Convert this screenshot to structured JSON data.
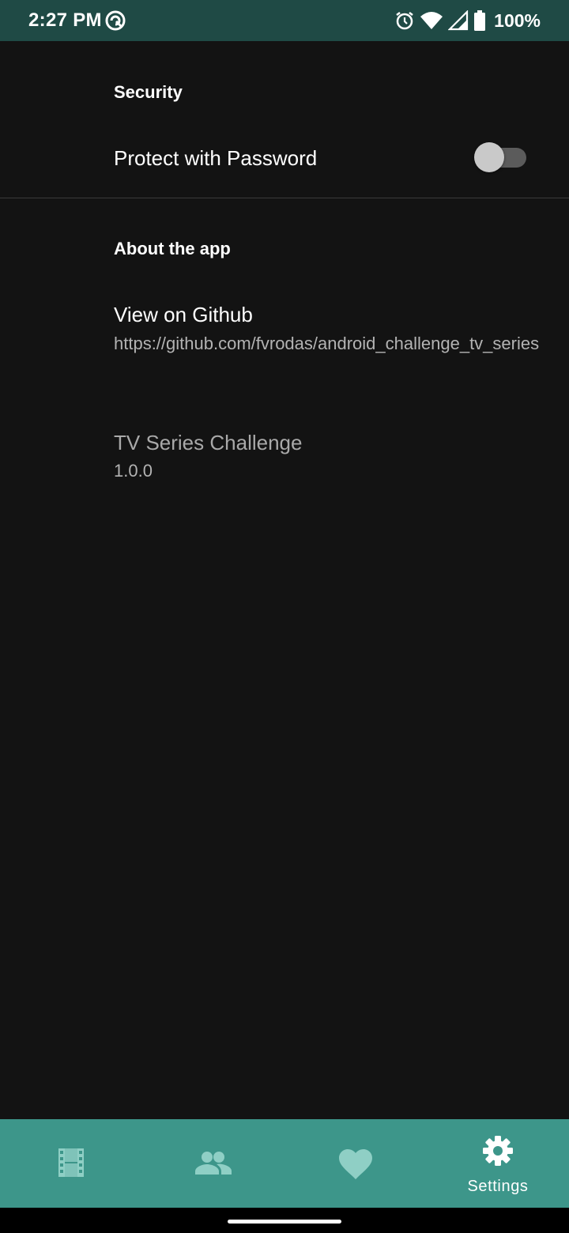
{
  "status_bar": {
    "time": "2:27 PM",
    "battery_percent": "100%",
    "icons": [
      "q-circle-icon",
      "alarm-icon",
      "wifi-icon",
      "cell-signal-icon",
      "battery-icon"
    ]
  },
  "settings": {
    "security": {
      "header": "Security",
      "protect_title": "Protect with Password",
      "protect_enabled": false
    },
    "about": {
      "header": "About the app",
      "github_title": "View on Github",
      "github_url": "https://github.com/fvrodas/android_challenge_tv_series",
      "app_name": "TV Series Challenge",
      "app_version": "1.0.0"
    }
  },
  "bottom_nav": {
    "items": [
      {
        "icon": "film-icon",
        "label": "",
        "active": false
      },
      {
        "icon": "people-icon",
        "label": "",
        "active": false
      },
      {
        "icon": "heart-icon",
        "label": "",
        "active": false
      },
      {
        "icon": "gear-icon",
        "label": "Settings",
        "active": true
      }
    ]
  },
  "colors": {
    "background": "#131313",
    "status_bar": "#1f4a45",
    "bottom_nav": "#3d968a",
    "nav_icon_inactive": "#8fcfc5",
    "nav_icon_active": "#ffffff"
  }
}
